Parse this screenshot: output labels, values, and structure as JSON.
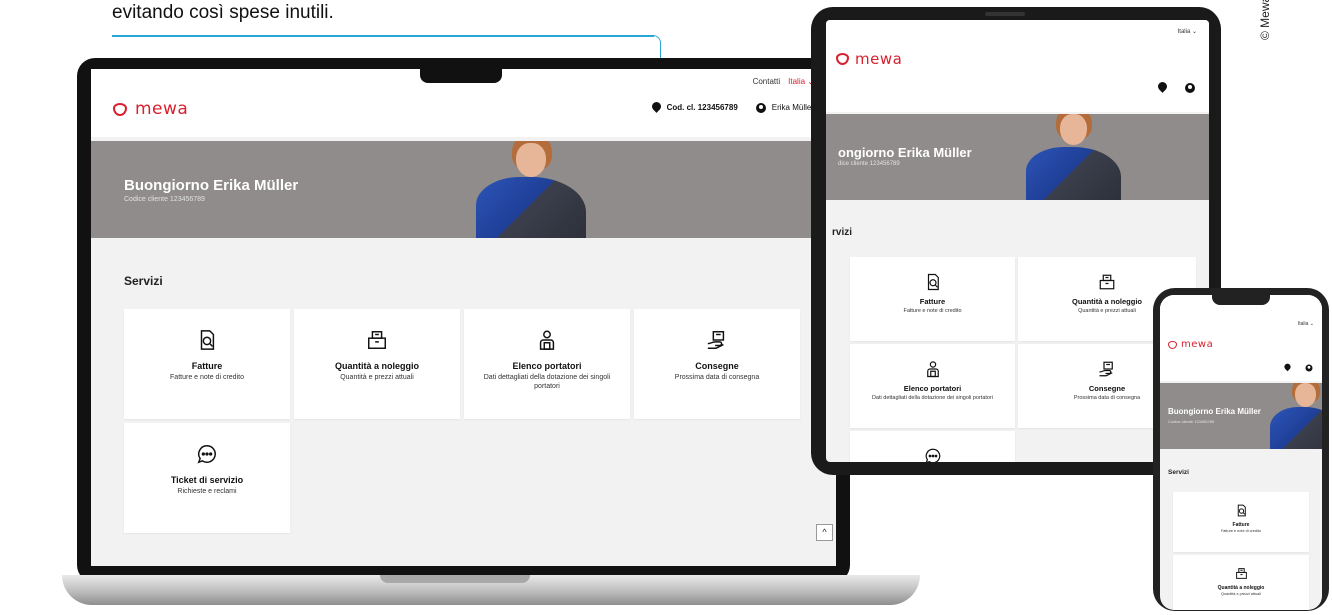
{
  "caption": "evitando così spese inutili.",
  "copyright": "© Mewa",
  "brand": {
    "name": "mewa",
    "color": "#d8202e",
    "accent_callout": "#2aa5d8"
  },
  "portal": {
    "util_nav": {
      "contacts": "Contatti",
      "language": "Italia"
    },
    "customer_number_label": "Cod. cl. 123456789",
    "user_name": "Erika Müller",
    "greeting": "Buongiorno Erika Müller",
    "customer_code_line": "Codice cliente 123456789",
    "services_title": "Servizi",
    "back_to_top": "^",
    "services": [
      {
        "icon": "invoice-icon",
        "title": "Fatture",
        "desc": "Fatture e note di credito"
      },
      {
        "icon": "rental-box-icon",
        "title": "Quantità a noleggio",
        "desc": "Quantità e prezzi attuali"
      },
      {
        "icon": "wearer-icon",
        "title": "Elenco portatori",
        "desc": "Dati dettagliati della dotazione dei singoli portatori"
      },
      {
        "icon": "delivery-icon",
        "title": "Consegne",
        "desc": "Prossima data di consegna"
      },
      {
        "icon": "chat-icon",
        "title": "Ticket di servizio",
        "desc": "Richieste e reclami"
      }
    ]
  },
  "tablet": {
    "language": "Italia",
    "greeting": "ongiorno Erika Müller",
    "customer_code_line": "dice cliente 123456789",
    "services_title": "rvizi"
  },
  "phone": {
    "language": "Italia"
  }
}
